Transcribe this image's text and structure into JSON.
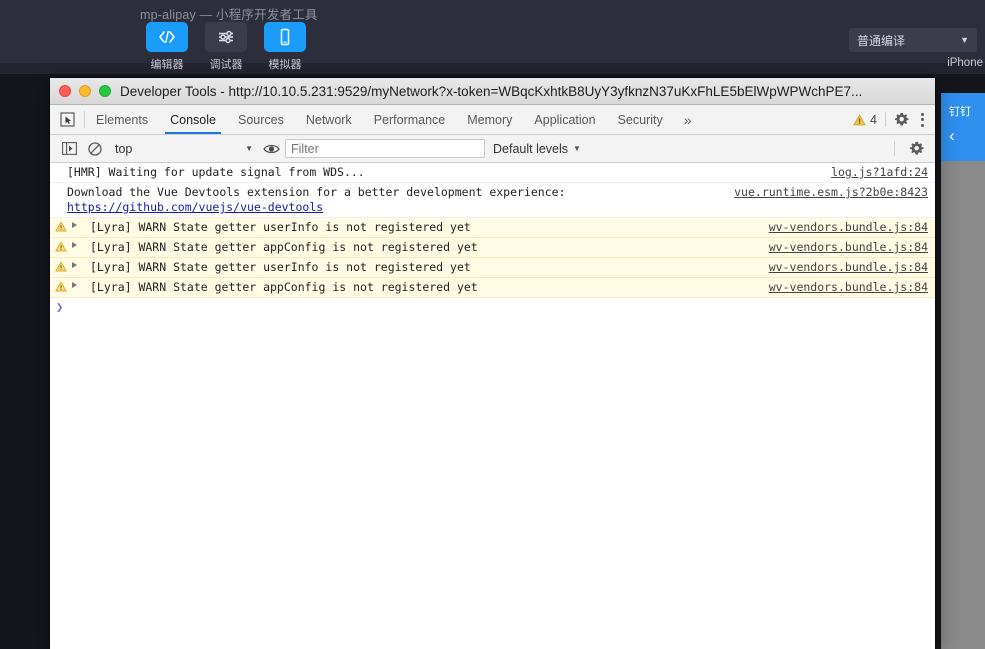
{
  "ide": {
    "title": "mp-alipay — 小程序开发者工具",
    "tools": [
      {
        "label": "编辑器",
        "icon": "code-icon",
        "state": "active"
      },
      {
        "label": "调试器",
        "icon": "sliders-icon",
        "state": "idle"
      },
      {
        "label": "模拟器",
        "icon": "phone-icon",
        "state": "active"
      }
    ],
    "compile_mode": "普通编译",
    "chevron": "▼",
    "simulator": {
      "device_label": "iPhone",
      "nav_title": "钉钉",
      "back_icon": "chevron-left-icon"
    }
  },
  "devtools": {
    "window_title": "Developer Tools - http://10.10.5.231:9529/myNetwork?x-token=WBqcKxhtkB8UyY3yfknzN37uKxFhLE5bElWpWPWchPE7...",
    "tabs": [
      {
        "label": "Elements",
        "active": false
      },
      {
        "label": "Console",
        "active": true
      },
      {
        "label": "Sources",
        "active": false
      },
      {
        "label": "Network",
        "active": false
      },
      {
        "label": "Performance",
        "active": false
      },
      {
        "label": "Memory",
        "active": false
      },
      {
        "label": "Application",
        "active": false
      },
      {
        "label": "Security",
        "active": false
      }
    ],
    "more_tabs": "»",
    "warning_count": "4",
    "filterbar": {
      "context": "top",
      "context_chevron": "▼",
      "filter_placeholder": "Filter",
      "filter_value": "",
      "levels": "Default levels",
      "levels_chevron": "▼"
    },
    "messages": [
      {
        "level": "info",
        "text": "[HMR] Waiting for update signal from WDS...",
        "link": "",
        "source": "log.js?1afd:24"
      },
      {
        "level": "info",
        "text": "Download the Vue Devtools extension for a better development experience:",
        "link": "https://github.com/vuejs/vue-devtools",
        "source": "vue.runtime.esm.js?2b0e:8423"
      },
      {
        "level": "warn",
        "text": "[Lyra] WARN State getter userInfo is not registered yet",
        "link": "",
        "source": "wv-vendors.bundle.js:84"
      },
      {
        "level": "warn",
        "text": "[Lyra] WARN State getter appConfig is not registered yet",
        "link": "",
        "source": "wv-vendors.bundle.js:84"
      },
      {
        "level": "warn",
        "text": "[Lyra] WARN State getter userInfo is not registered yet",
        "link": "",
        "source": "wv-vendors.bundle.js:84"
      },
      {
        "level": "warn",
        "text": "[Lyra] WARN State getter appConfig is not registered yet",
        "link": "",
        "source": "wv-vendors.bundle.js:84"
      }
    ],
    "prompt_caret": "❯"
  },
  "colors": {
    "accent_blue": "#1a9dfa",
    "tab_underline": "#1a73e8",
    "warn_bg": "#fffbe5",
    "warn_icon": "#e8b339",
    "ide_bg": "#2c2e3b",
    "sim_nav": "#2f90f0"
  }
}
